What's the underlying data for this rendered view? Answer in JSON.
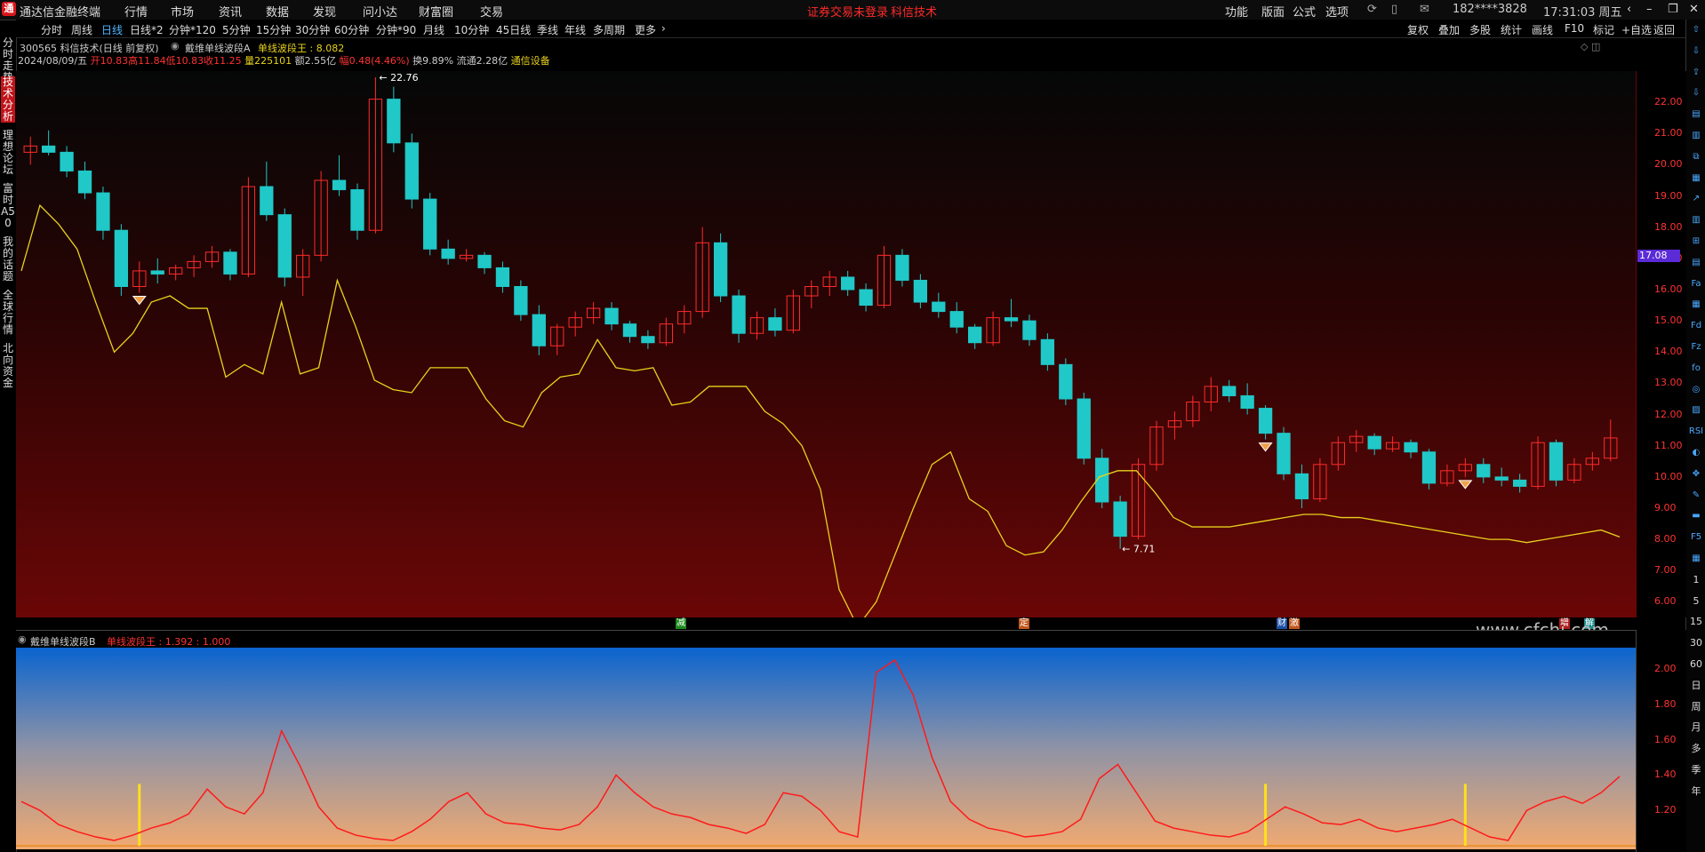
{
  "app": {
    "name": "通达信金融终端",
    "logo_text": "通"
  },
  "menu": [
    "行情",
    "市场",
    "资讯",
    "数据",
    "发现",
    "问小达",
    "财富圈",
    "交易"
  ],
  "status": {
    "warning": "证券交易未登录",
    "stock_name": "科信技术"
  },
  "top_right": [
    "功能",
    "版面",
    "公式",
    "选项"
  ],
  "account": "182****3828",
  "clock": "17:31:03 周五",
  "periods": [
    "分时",
    "周线",
    "日线",
    "日线*2",
    "分钟*120",
    "5分钟",
    "15分钟",
    "30分钟",
    "60分钟",
    "分钟*90",
    "月线",
    "10分钟",
    "45日线",
    "季线",
    "年线",
    "多周期",
    "更多"
  ],
  "active_period": "日线",
  "period_right": [
    "复权",
    "叠加",
    "多股",
    "统计",
    "画线",
    "F10",
    "标记",
    "+自选",
    "返回"
  ],
  "left_tabs": [
    "分时走势",
    "技术分析",
    "理想论坛",
    "富时A50",
    "我的话题",
    "全球行情",
    "北向资金"
  ],
  "right_tools": [
    "⇧",
    "⇩",
    "⇪",
    "⇩",
    "▤",
    "▥",
    "⧉",
    "▦",
    "↗",
    "▥",
    "⊞",
    "▤",
    "Fa",
    "▦",
    "Fd",
    "Fz",
    "fo",
    "◎",
    "▨",
    "RSI",
    "◐",
    "✥",
    "✎",
    "▬",
    "F5",
    "▦",
    "1",
    "5",
    "15",
    "30",
    "60",
    "日",
    "周",
    "月",
    "多",
    "季",
    "年"
  ],
  "header": {
    "title_line": "300565 科信技术(日线 前复权)",
    "indicator_a_name": "戴维单线波段A",
    "indicator_a_value_text": "单线波段王 : 8.082",
    "date": "2024/08/09/五",
    "open": "开10.83",
    "high": "高11.84",
    "low": "低10.83",
    "close": "收11.25",
    "volume": "量225101",
    "amount": "额2.55亿",
    "change": "幅0.48(4.46%)",
    "turnover": "换9.89%",
    "float_cap": "流通2.28亿",
    "sector": "通信设备"
  },
  "sub_header": {
    "name": "戴维单线波段B",
    "value_text": "单线波段王 : 1.392 : 1.000"
  },
  "watermark": "www.cfchi.com",
  "price_axis": [
    "22.00",
    "21.00",
    "20.00",
    "19.00",
    "18.00",
    "17.00",
    "16.00",
    "15.00",
    "14.00",
    "13.00",
    "12.00",
    "11.00",
    "10.00",
    "9.00",
    "8.00",
    "7.00",
    "6.00"
  ],
  "sub_axis": [
    "2.00",
    "1.80",
    "1.60",
    "1.40",
    "1.20"
  ],
  "current_price": "17.08",
  "high_mark": "22.76",
  "low_mark": "7.71",
  "events": [
    {
      "label": "减",
      "color": "#1c8a1c"
    },
    {
      "label": "定",
      "color": "#c2571c"
    },
    {
      "label": "财",
      "color": "#1c4fa8"
    },
    {
      "label": "激",
      "color": "#c2571c"
    },
    {
      "label": "增",
      "color": "#b01c1c"
    },
    {
      "label": "解",
      "color": "#1c8a8a"
    }
  ],
  "colors": {
    "up": "#ff2b2b",
    "down": "#20c8c8",
    "line_a": "#e8d21c",
    "line_b": "#ff1a1a",
    "signal": "#ffe01a"
  },
  "chart_data": [
    {
      "type": "candlestick",
      "title": "戴维单线波段A",
      "ylim": [
        5.5,
        23
      ],
      "ohlc": [
        [
          20.4,
          20.9,
          20.0,
          20.6
        ],
        [
          20.6,
          21.1,
          20.3,
          20.4
        ],
        [
          20.4,
          20.6,
          19.6,
          19.8
        ],
        [
          19.8,
          20.1,
          18.9,
          19.1
        ],
        [
          19.1,
          19.3,
          17.6,
          17.9
        ],
        [
          17.9,
          18.1,
          15.8,
          16.1
        ],
        [
          16.1,
          16.9,
          15.9,
          16.6
        ],
        [
          16.6,
          17.0,
          16.2,
          16.5
        ],
        [
          16.5,
          16.8,
          16.3,
          16.7
        ],
        [
          16.7,
          17.1,
          16.4,
          16.9
        ],
        [
          16.9,
          17.4,
          16.7,
          17.2
        ],
        [
          17.2,
          17.3,
          16.3,
          16.5
        ],
        [
          16.5,
          19.6,
          16.4,
          19.3
        ],
        [
          19.3,
          20.1,
          18.2,
          18.4
        ],
        [
          18.4,
          18.6,
          16.1,
          16.4
        ],
        [
          16.4,
          17.3,
          15.8,
          17.1
        ],
        [
          17.1,
          19.8,
          16.9,
          19.5
        ],
        [
          19.5,
          20.3,
          19.0,
          19.2
        ],
        [
          19.2,
          19.4,
          17.6,
          17.9
        ],
        [
          17.9,
          22.8,
          17.8,
          22.1
        ],
        [
          22.1,
          22.5,
          20.4,
          20.7
        ],
        [
          20.7,
          21.0,
          18.6,
          18.9
        ],
        [
          18.9,
          19.1,
          17.1,
          17.3
        ],
        [
          17.3,
          17.6,
          16.8,
          17.0
        ],
        [
          17.0,
          17.3,
          16.9,
          17.1
        ],
        [
          17.1,
          17.2,
          16.5,
          16.7
        ],
        [
          16.7,
          16.9,
          15.9,
          16.1
        ],
        [
          16.1,
          16.3,
          15.0,
          15.2
        ],
        [
          15.2,
          15.5,
          13.9,
          14.2
        ],
        [
          14.2,
          14.9,
          13.9,
          14.8
        ],
        [
          14.8,
          15.3,
          14.5,
          15.1
        ],
        [
          15.1,
          15.6,
          14.9,
          15.4
        ],
        [
          15.4,
          15.6,
          14.7,
          14.9
        ],
        [
          14.9,
          15.0,
          14.3,
          14.5
        ],
        [
          14.5,
          14.7,
          14.1,
          14.3
        ],
        [
          14.3,
          15.1,
          14.2,
          14.9
        ],
        [
          14.9,
          15.5,
          14.6,
          15.3
        ],
        [
          15.3,
          18.0,
          15.1,
          17.5
        ],
        [
          17.5,
          17.8,
          15.6,
          15.8
        ],
        [
          15.8,
          16.0,
          14.3,
          14.6
        ],
        [
          14.6,
          15.3,
          14.4,
          15.1
        ],
        [
          15.1,
          15.4,
          14.5,
          14.7
        ],
        [
          14.7,
          16.0,
          14.6,
          15.8
        ],
        [
          15.8,
          16.3,
          15.4,
          16.1
        ],
        [
          16.1,
          16.6,
          15.8,
          16.4
        ],
        [
          16.4,
          16.6,
          15.8,
          16.0
        ],
        [
          16.0,
          16.2,
          15.3,
          15.5
        ],
        [
          15.5,
          17.4,
          15.4,
          17.1
        ],
        [
          17.1,
          17.3,
          16.1,
          16.3
        ],
        [
          16.3,
          16.5,
          15.4,
          15.6
        ],
        [
          15.6,
          15.9,
          15.1,
          15.3
        ],
        [
          15.3,
          15.6,
          14.6,
          14.8
        ],
        [
          14.8,
          14.9,
          14.1,
          14.3
        ],
        [
          14.3,
          15.3,
          14.2,
          15.1
        ],
        [
          15.1,
          15.7,
          14.8,
          15.0
        ],
        [
          15.0,
          15.2,
          14.2,
          14.4
        ],
        [
          14.4,
          14.6,
          13.4,
          13.6
        ],
        [
          13.6,
          13.8,
          12.3,
          12.5
        ],
        [
          12.5,
          12.7,
          10.4,
          10.6
        ],
        [
          10.6,
          10.9,
          9.0,
          9.2
        ],
        [
          9.2,
          9.4,
          7.7,
          8.1
        ],
        [
          8.1,
          10.6,
          8.0,
          10.4
        ],
        [
          10.4,
          11.8,
          10.2,
          11.6
        ],
        [
          11.6,
          12.1,
          11.2,
          11.8
        ],
        [
          11.8,
          12.6,
          11.6,
          12.4
        ],
        [
          12.4,
          13.2,
          12.1,
          12.9
        ],
        [
          12.9,
          13.1,
          12.4,
          12.6
        ],
        [
          12.6,
          13.0,
          12.0,
          12.2
        ],
        [
          12.2,
          12.3,
          11.2,
          11.4
        ],
        [
          11.4,
          11.6,
          9.9,
          10.1
        ],
        [
          10.1,
          10.4,
          9.0,
          9.3
        ],
        [
          9.3,
          10.6,
          9.2,
          10.4
        ],
        [
          10.4,
          11.3,
          10.2,
          11.1
        ],
        [
          11.1,
          11.5,
          10.8,
          11.3
        ],
        [
          11.3,
          11.4,
          10.7,
          10.9
        ],
        [
          10.9,
          11.3,
          10.8,
          11.1
        ],
        [
          11.1,
          11.2,
          10.6,
          10.8
        ],
        [
          10.8,
          10.9,
          9.6,
          9.8
        ],
        [
          9.8,
          10.4,
          9.7,
          10.2
        ],
        [
          10.2,
          10.6,
          10.0,
          10.4
        ],
        [
          10.4,
          10.6,
          9.8,
          10.0
        ],
        [
          10.0,
          10.3,
          9.7,
          9.9
        ],
        [
          9.9,
          10.1,
          9.5,
          9.7
        ],
        [
          9.7,
          11.3,
          9.6,
          11.1
        ],
        [
          11.1,
          11.2,
          9.7,
          9.9
        ],
        [
          9.9,
          10.6,
          9.8,
          10.4
        ],
        [
          10.4,
          10.8,
          10.2,
          10.6
        ],
        [
          10.6,
          11.84,
          10.5,
          11.25
        ]
      ],
      "series": [
        {
          "name": "单线波段王",
          "values": [
            16.6,
            18.7,
            18.1,
            17.3,
            15.6,
            14.0,
            14.6,
            15.6,
            15.8,
            15.4,
            15.4,
            13.2,
            13.6,
            13.3,
            15.6,
            13.3,
            13.5,
            16.3,
            14.8,
            13.1,
            12.8,
            12.7,
            13.5,
            13.5,
            13.5,
            12.5,
            11.8,
            11.6,
            12.7,
            13.2,
            13.3,
            14.4,
            13.5,
            13.4,
            13.5,
            12.3,
            12.4,
            12.9,
            12.9,
            12.9,
            12.1,
            11.7,
            11.0,
            9.6,
            6.4,
            5.2,
            6.0,
            7.5,
            9.0,
            10.4,
            10.8,
            9.3,
            8.9,
            7.8,
            7.5,
            7.6,
            8.3,
            9.2,
            10.0,
            10.2,
            10.2,
            9.5,
            8.7,
            8.4,
            8.4,
            8.4,
            8.5,
            8.6,
            8.7,
            8.8,
            8.8,
            8.7,
            8.7,
            8.6,
            8.5,
            8.4,
            8.3,
            8.2,
            8.1,
            8.0,
            8.0,
            7.9,
            8.0,
            8.1,
            8.2,
            8.3,
            8.08
          ]
        }
      ],
      "signals_at_index": [
        6,
        68,
        79
      ]
    },
    {
      "type": "line",
      "title": "戴维单线波段B",
      "ylim": [
        1.0,
        2.1
      ],
      "series": [
        {
          "name": "单线波段王",
          "values": [
            1.25,
            1.2,
            1.12,
            1.08,
            1.05,
            1.03,
            1.06,
            1.1,
            1.13,
            1.18,
            1.32,
            1.22,
            1.18,
            1.3,
            1.65,
            1.45,
            1.22,
            1.1,
            1.06,
            1.04,
            1.03,
            1.08,
            1.15,
            1.25,
            1.3,
            1.18,
            1.13,
            1.12,
            1.1,
            1.09,
            1.12,
            1.22,
            1.4,
            1.3,
            1.22,
            1.18,
            1.16,
            1.12,
            1.1,
            1.07,
            1.12,
            1.3,
            1.28,
            1.2,
            1.08,
            1.05,
            1.98,
            2.05,
            1.85,
            1.5,
            1.25,
            1.15,
            1.1,
            1.08,
            1.05,
            1.06,
            1.08,
            1.15,
            1.38,
            1.46,
            1.3,
            1.14,
            1.1,
            1.08,
            1.06,
            1.05,
            1.08,
            1.15,
            1.22,
            1.18,
            1.13,
            1.12,
            1.15,
            1.1,
            1.08,
            1.1,
            1.12,
            1.15,
            1.1,
            1.05,
            1.03,
            1.2,
            1.25,
            1.28,
            1.24,
            1.3,
            1.392
          ]
        },
        {
          "name": "1.000",
          "values": [
            1.0,
            1.0
          ]
        }
      ],
      "signals_at_index": [
        6,
        68,
        79
      ]
    }
  ]
}
